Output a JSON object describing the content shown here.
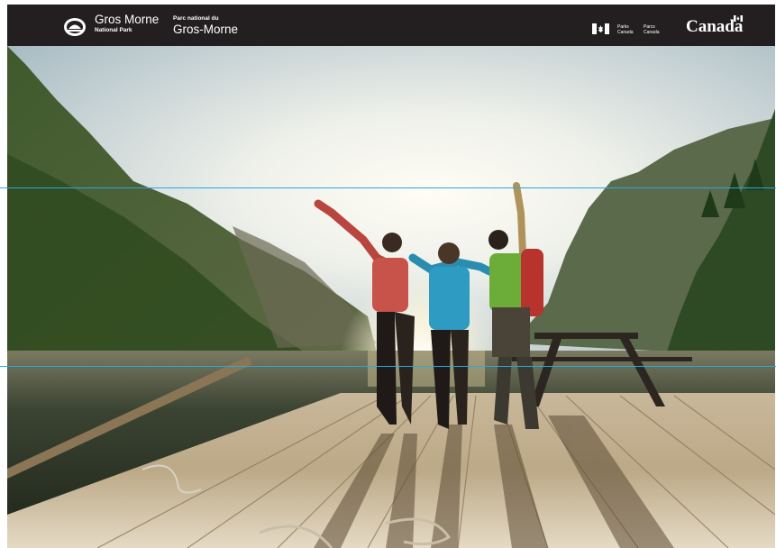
{
  "banner": {
    "name_en": "Gros Morne",
    "park_en": "National Park",
    "park_fr_prefix": "Parc national du",
    "name_fr": "Gros-Morne",
    "agency_en_1": "Parks",
    "agency_en_2": "Canada",
    "agency_fr_1": "Parcs",
    "agency_fr_2": "Canada",
    "wordmark": "Canada"
  },
  "icons": [
    "parks-beaver-logo-icon",
    "canada-flag-icon",
    "wordmark-flag-icon"
  ],
  "colors": {
    "banner": "#231f20",
    "guide_lines": "#27a9e1",
    "sky": "#dfe6e2",
    "water": "#28332a"
  }
}
